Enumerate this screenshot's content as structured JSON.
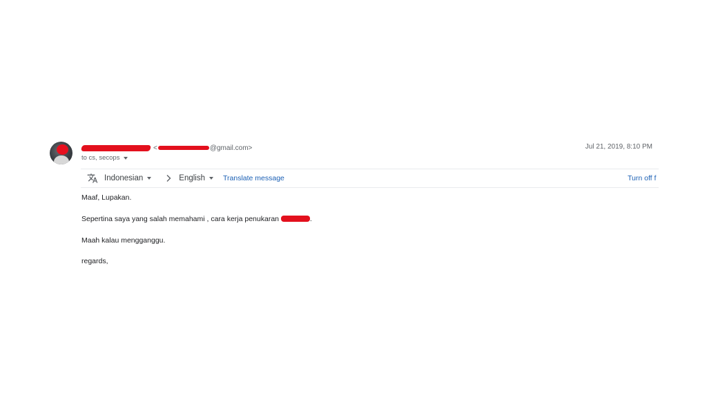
{
  "header": {
    "sender_email_domain": "@gmail.com>",
    "email_open_bracket": "<",
    "date": "Jul 21, 2019, 8:10 PM",
    "recipients": "to cs, secops"
  },
  "translate_bar": {
    "source_language": "Indonesian",
    "target_language": "English",
    "translate_link": "Translate message",
    "turn_off_link": "Turn off f"
  },
  "message": {
    "line1": "Maaf, Lupakan.",
    "line2_prefix": "Sepertina saya yang salah memahami , cara kerja penukaran",
    "line2_suffix": ".",
    "line3": "Maah kalau mengganggu.",
    "line4": "regards,"
  },
  "colors": {
    "redaction": "#e3101d",
    "link": "#1a5fb4",
    "secondary_text": "#5f6368"
  },
  "icons": {
    "translate": "translate-icon",
    "chevron": "chevron-right-icon",
    "dropdown": "caret-down-icon"
  }
}
